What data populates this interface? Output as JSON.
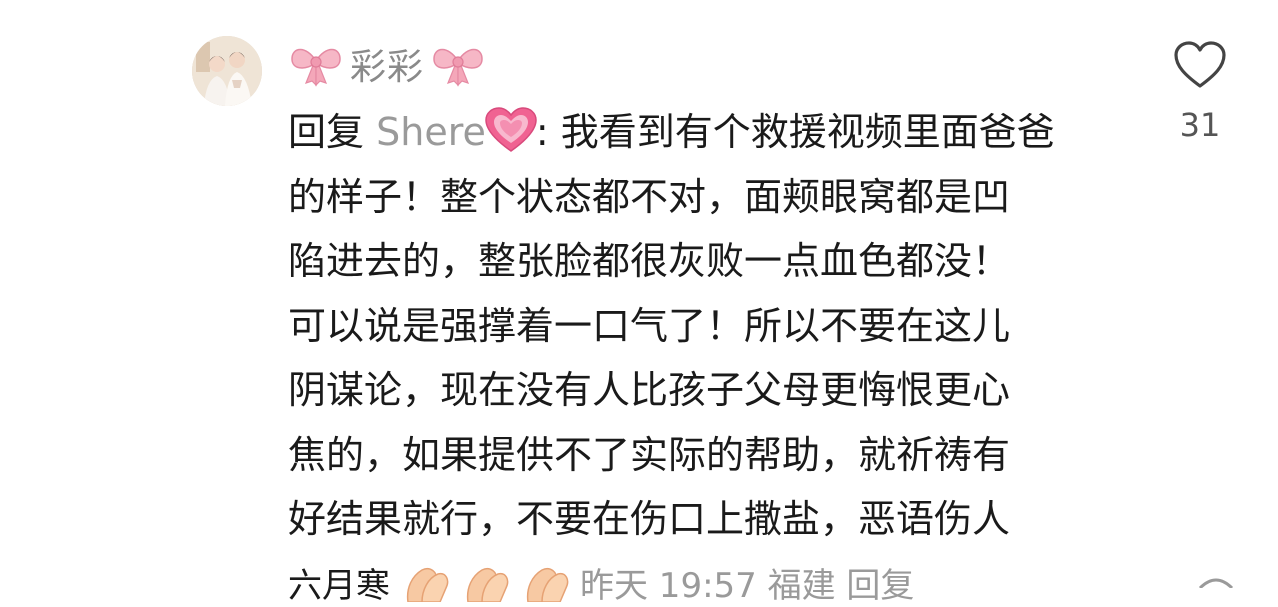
{
  "comment": {
    "username": "彩彩",
    "reply_prefix": "回复",
    "mention": "Shere",
    "text_line1": ": 我看到有个救援视频里面爸爸",
    "text_line2": "的样子！整个状态都不对，面颊眼窝都是凹",
    "text_line3": "陷进去的，整张脸都很灰败一点血色都没！",
    "text_line4": "可以说是强撑着一口气了！所以不要在这儿",
    "text_line5": "阴谋论，现在没有人比孩子父母更悔恨更心",
    "text_line6": "焦的，如果提供不了实际的帮助，就祈祷有",
    "text_line7": "好结果就行，不要在伤口上撒盐，恶语伤人",
    "text_line8_partial": "六月寒",
    "meta_partial": "昨天 19:57 福建 回复"
  },
  "like": {
    "count": "31"
  },
  "icons": {
    "username_decor": "pink-bow-icon",
    "mention_decor": "pink-heart-icon",
    "like": "heart-outline-icon",
    "emoji": "clapping-hands-icon"
  },
  "colors": {
    "text": "#1a1a1a",
    "muted": "#9a9a9a",
    "bow_pink": "#f4a7b9",
    "heart_pink": "#f06292"
  }
}
